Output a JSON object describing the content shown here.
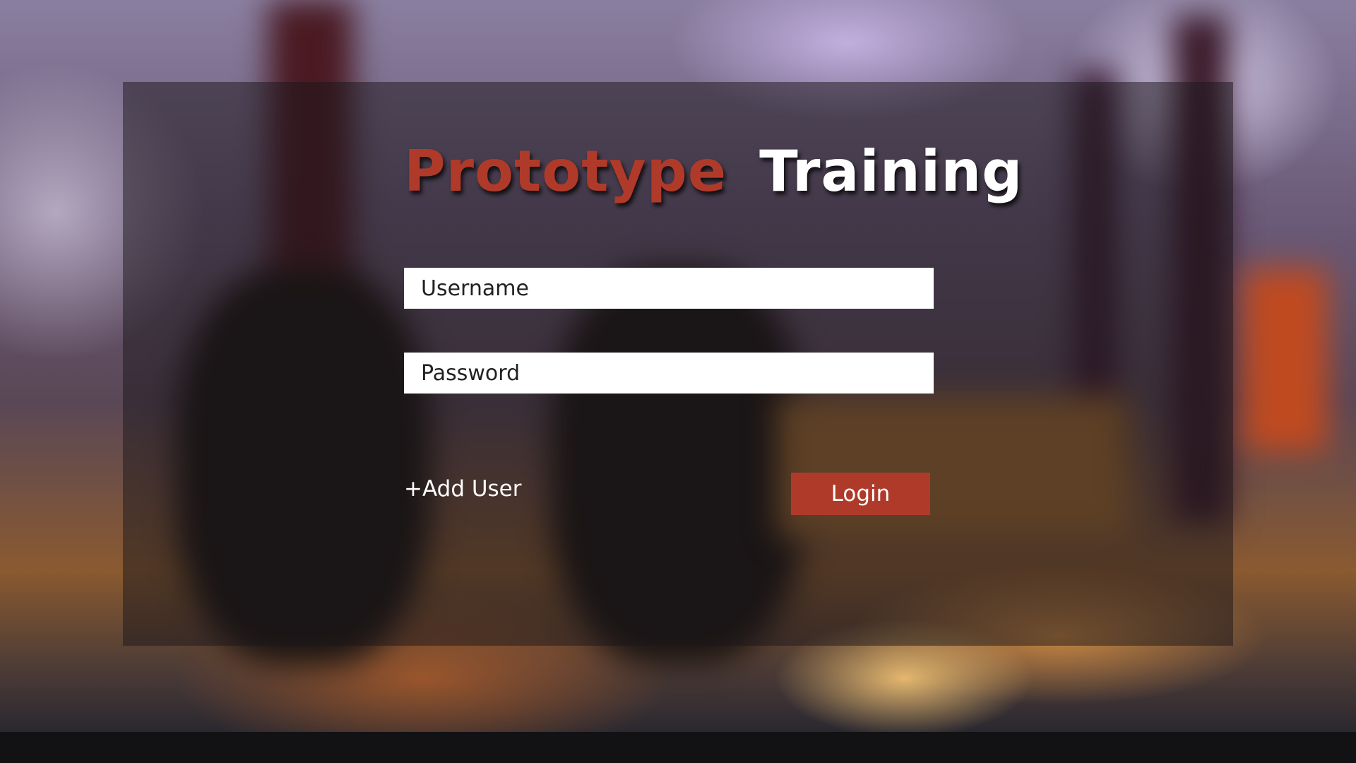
{
  "app": {
    "title_part1": "Prototype",
    "title_part2": "Training"
  },
  "form": {
    "username_placeholder": "Username",
    "username_value": "",
    "password_placeholder": "Password",
    "password_value": ""
  },
  "actions": {
    "add_user_label": "+Add User",
    "login_label": "Login"
  },
  "colors": {
    "brand_red": "#b03a2a",
    "title_white": "#ffffff",
    "panel_overlay": "rgba(25,22,25,0.5)"
  },
  "background": {
    "description_icon": "blurred-gym-photo"
  }
}
